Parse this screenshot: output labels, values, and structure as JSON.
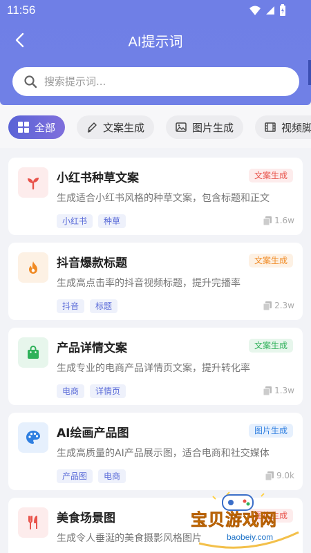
{
  "status_bar": {
    "time": "11:56"
  },
  "header": {
    "title": "AI提示词"
  },
  "search": {
    "placeholder": "搜索提示词..."
  },
  "tabs": [
    {
      "label": "全部",
      "icon": "grid-icon",
      "active": true
    },
    {
      "label": "文案生成",
      "icon": "pen-icon",
      "active": false
    },
    {
      "label": "图片生成",
      "icon": "image-icon",
      "active": false
    },
    {
      "label": "视频脚",
      "icon": "film-icon",
      "active": false
    }
  ],
  "cards": [
    {
      "title": "小红书种草文案",
      "badge": "文案生成",
      "badge_color": "#e8524a",
      "badge_bg": "#fdecec",
      "description": "生成适合小红书风格的种草文案，包含标题和正文",
      "tags": [
        "小红书",
        "种草"
      ],
      "count": "1.6w",
      "icon": "sprout-icon",
      "icon_color": "#e8524a",
      "icon_bg": "#fdecec"
    },
    {
      "title": "抖音爆款标题",
      "badge": "文案生成",
      "badge_color": "#f08a24",
      "badge_bg": "#fdf1e4",
      "description": "生成高点击率的抖音视频标题，提升完播率",
      "tags": [
        "抖音",
        "标题"
      ],
      "count": "2.3w",
      "icon": "fire-icon",
      "icon_color": "#f08a24",
      "icon_bg": "#fdf1e4"
    },
    {
      "title": "产品详情文案",
      "badge": "文案生成",
      "badge_color": "#2fb15a",
      "badge_bg": "#e7f6ec",
      "description": "生成专业的电商产品详情页文案，提升转化率",
      "tags": [
        "电商",
        "详情页"
      ],
      "count": "1.3w",
      "icon": "shopping-bag-icon",
      "icon_color": "#2fb15a",
      "icon_bg": "#e7f6ec"
    },
    {
      "title": "AI绘画产品图",
      "badge": "图片生成",
      "badge_color": "#2f7fe0",
      "badge_bg": "#e6f0fd",
      "description": "生成高质量的AI产品展示图，适合电商和社交媒体",
      "tags": [
        "产品图",
        "电商"
      ],
      "count": "9.0k",
      "icon": "palette-icon",
      "icon_color": "#2f7fe0",
      "icon_bg": "#e6f0fd"
    },
    {
      "title": "美食场景图",
      "badge": "图片生成",
      "badge_color": "#e8524a",
      "badge_bg": "#fdecec",
      "description": "生成令人垂涎的美食摄影风格图片",
      "tags": [],
      "count": "",
      "icon": "utensils-icon",
      "icon_color": "#e8524a",
      "icon_bg": "#fdecec"
    }
  ],
  "watermark": {
    "text": "宝贝游戏网",
    "url": "baobeiy.com"
  }
}
